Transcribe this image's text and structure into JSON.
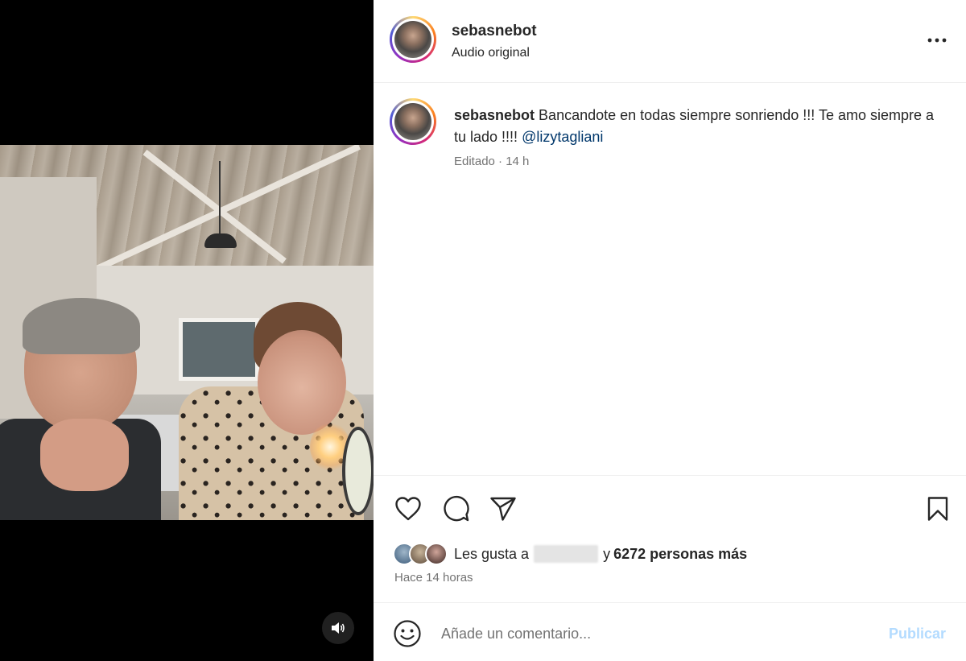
{
  "post": {
    "username": "sebasnebot",
    "audio_label": "Audio original"
  },
  "caption": {
    "username": "sebasnebot",
    "text": "Bancandote en todas siempre sonriendo !!! Te amo siempre a tu lado !!!! ",
    "mention": "@lizytagliani",
    "meta": "Editado · 14 h"
  },
  "actions": {
    "icons": [
      "heart-icon",
      "comment-icon",
      "share-icon",
      "bookmark-icon"
    ]
  },
  "likes": {
    "prefix": "Les gusta a",
    "connector": "y",
    "count_text": "6272 personas más",
    "time_ago": "Hace 14 horas"
  },
  "comment": {
    "placeholder": "Añade un comentario...",
    "publish_label": "Publicar"
  },
  "colors": {
    "link": "#00376b",
    "publish_disabled": "#b3dbff",
    "secondary_text": "#737373"
  }
}
